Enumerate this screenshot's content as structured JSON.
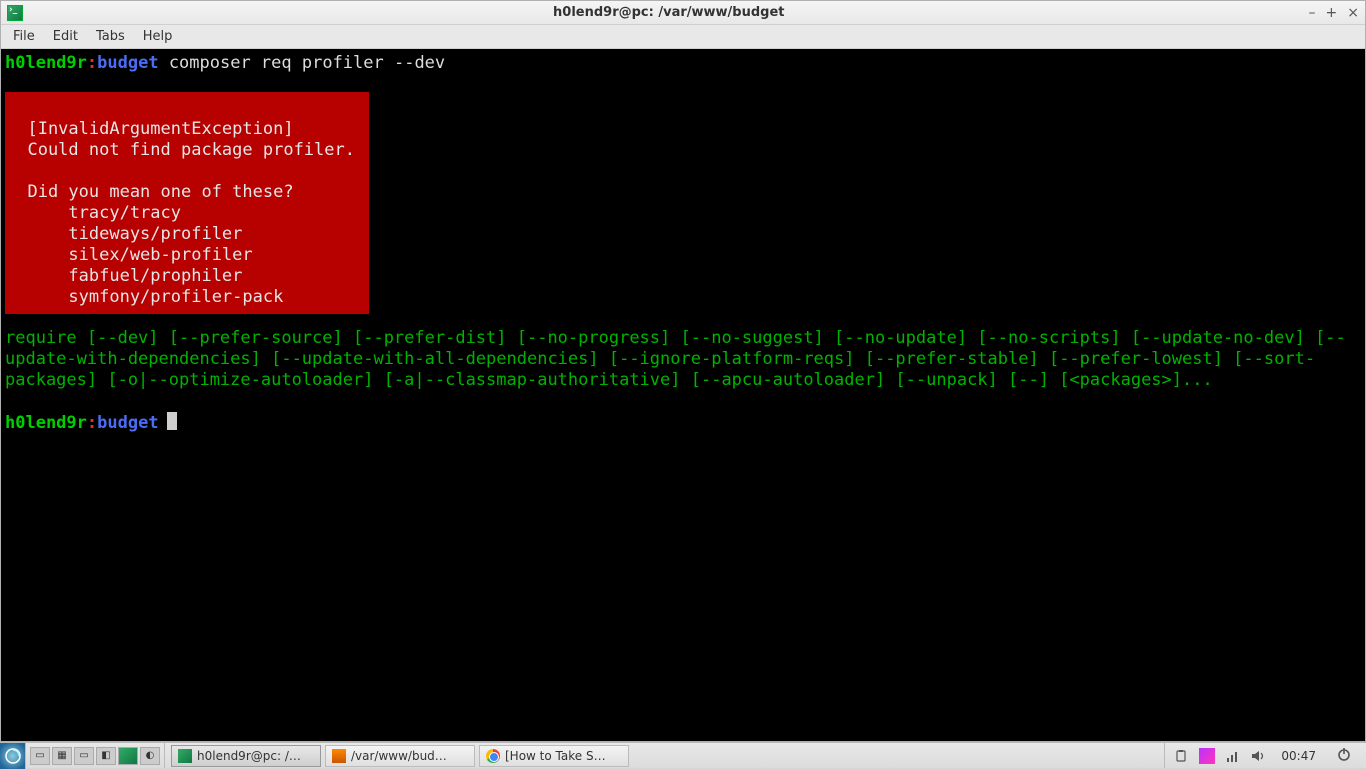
{
  "window": {
    "title": "h0lend9r@pc: /var/www/budget",
    "menus": [
      "File",
      "Edit",
      "Tabs",
      "Help"
    ]
  },
  "prompt": {
    "user": "h0lend9r",
    "colon": ":",
    "dir": "budget",
    "command": "composer req profiler --dev"
  },
  "error": {
    "exception": "  [InvalidArgumentException]",
    "message": "  Could not find package profiler.",
    "question": "  Did you mean one of these?",
    "suggestions": [
      "      tracy/tracy",
      "      tideways/profiler",
      "      silex/web-profiler",
      "      fabfuel/prophiler",
      "      symfony/profiler-pack"
    ]
  },
  "usage": "require [--dev] [--prefer-source] [--prefer-dist] [--no-progress] [--no-suggest] [--no-update] [--no-scripts] [--update-no-dev] [--update-with-dependencies] [--update-with-all-dependencies] [--ignore-platform-reqs] [--prefer-stable] [--prefer-lowest] [--sort-packages] [-o|--optimize-autoloader] [-a|--classmap-authoritative] [--apcu-autoloader] [--unpack] [--] [<packages>]...",
  "taskbar": {
    "tasks": [
      {
        "label": "h0lend9r@pc: /…",
        "icon": "term",
        "active": true
      },
      {
        "label": "/var/www/bud…",
        "icon": "subl",
        "active": false
      },
      {
        "label": "[How to Take S…",
        "icon": "chrome",
        "active": false
      }
    ],
    "clock": "00:47"
  }
}
